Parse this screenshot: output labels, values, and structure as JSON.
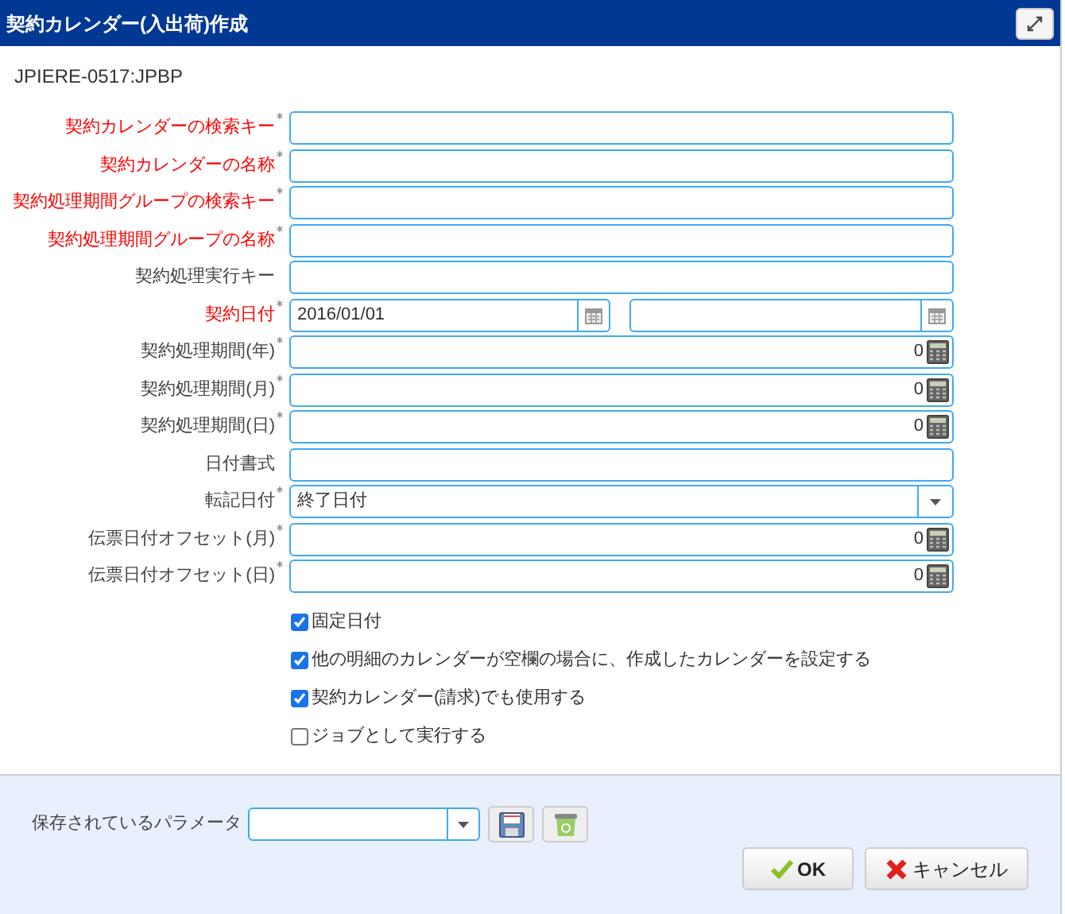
{
  "window": {
    "title": "契約カレンダー(入出荷)作成"
  },
  "process_id": "JPIERE-0517:JPBP",
  "fields": [
    {
      "label": "契約カレンダーの検索キー",
      "required": true,
      "mandatory": true,
      "kind": "text"
    },
    {
      "label": "契約カレンダーの名称",
      "required": true,
      "mandatory": true,
      "kind": "text"
    },
    {
      "label": "契約処理期間グループの検索キー",
      "required": true,
      "mandatory": true,
      "kind": "text"
    },
    {
      "label": "契約処理期間グループの名称",
      "required": true,
      "mandatory": true,
      "kind": "text"
    },
    {
      "label": "契約処理実行キー",
      "required": false,
      "mandatory": false,
      "kind": "text"
    },
    {
      "label": "契約日付",
      "required": true,
      "mandatory": true,
      "kind": "daterange",
      "value": "2016/01/01"
    },
    {
      "label": "契約処理期間(年)",
      "required": true,
      "mandatory": false,
      "kind": "number",
      "value": "0"
    },
    {
      "label": "契約処理期間(月)",
      "required": true,
      "mandatory": false,
      "kind": "number",
      "value": "0"
    },
    {
      "label": "契約処理期間(日)",
      "required": true,
      "mandatory": false,
      "kind": "number",
      "value": "0"
    },
    {
      "label": "日付書式",
      "required": false,
      "mandatory": false,
      "kind": "text"
    },
    {
      "label": "転記日付",
      "required": true,
      "mandatory": false,
      "kind": "select",
      "value": "終了日付"
    },
    {
      "label": "伝票日付オフセット(月)",
      "required": true,
      "mandatory": false,
      "kind": "number",
      "value": "0"
    },
    {
      "label": "伝票日付オフセット(日)",
      "required": true,
      "mandatory": false,
      "kind": "number",
      "value": "0"
    }
  ],
  "options": [
    {
      "label": "固定日付",
      "checked": true
    },
    {
      "label": "他の明細のカレンダーが空欄の場合に、作成したカレンダーを設定する",
      "checked": true
    },
    {
      "label": "契約カレンダー(請求)でも使用する",
      "checked": true
    },
    {
      "label": "ジョブとして実行する",
      "checked": false
    }
  ],
  "saved_parameters": {
    "label": "保存されているパラメータ"
  },
  "buttons": [
    {
      "label": "OK",
      "kind": "ok"
    },
    {
      "label": "キャンセル",
      "kind": "cancel"
    }
  ]
}
